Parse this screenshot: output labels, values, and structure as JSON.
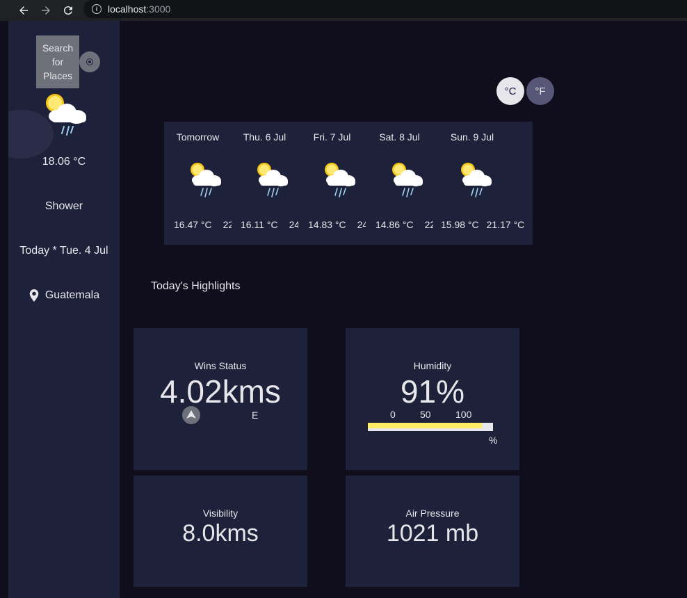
{
  "browser": {
    "url_host": "localhost",
    "url_port": ":3000"
  },
  "sidebar": {
    "search_label": "Search for Places",
    "current_icon": "light-rain-cloud-sun",
    "temperature": "18.06 °C",
    "condition": "Shower",
    "date": "Today * Tue. 4 Jul",
    "location": "Guatemala"
  },
  "units": {
    "celsius": "°C",
    "fahrenheit": "°F"
  },
  "forecast": [
    {
      "label": "Tomorrow",
      "min": "16.47 °C",
      "max": "22",
      "icon": "light-rain-cloud-sun"
    },
    {
      "label": "Thu. 6 Jul",
      "min": "16.11 °C",
      "max": "24.",
      "icon": "light-rain-cloud-sun"
    },
    {
      "label": "Fri. 7 Jul",
      "min": "14.83 °C",
      "max": "24.",
      "icon": "light-rain-cloud-sun"
    },
    {
      "label": "Sat. 8 Jul",
      "min": "14.86 °C",
      "max": "22.",
      "icon": "light-rain-cloud-sun"
    },
    {
      "label": "Sun. 9 Jul",
      "min": "15.98 °C",
      "max": "21.17 °C",
      "icon": "light-rain-cloud-sun"
    }
  ],
  "highlights": {
    "title": "Today's Highlights",
    "wind": {
      "title": "Wins Status",
      "value": "4.02kms",
      "direction": "E"
    },
    "humidity": {
      "title": "Humidity",
      "value": "91%",
      "scale": [
        "0",
        "50",
        "100"
      ],
      "unit": "%",
      "fraction": 0.91
    },
    "visibility": {
      "title": "Visibility",
      "value": "8.0kms"
    },
    "pressure": {
      "title": "Air Pressure",
      "value": "1021 mb"
    }
  },
  "colors": {
    "bg": "#100e1d",
    "panel": "#1e213a",
    "accent_yellow": "#ffec65",
    "text": "#e7e7eb"
  }
}
